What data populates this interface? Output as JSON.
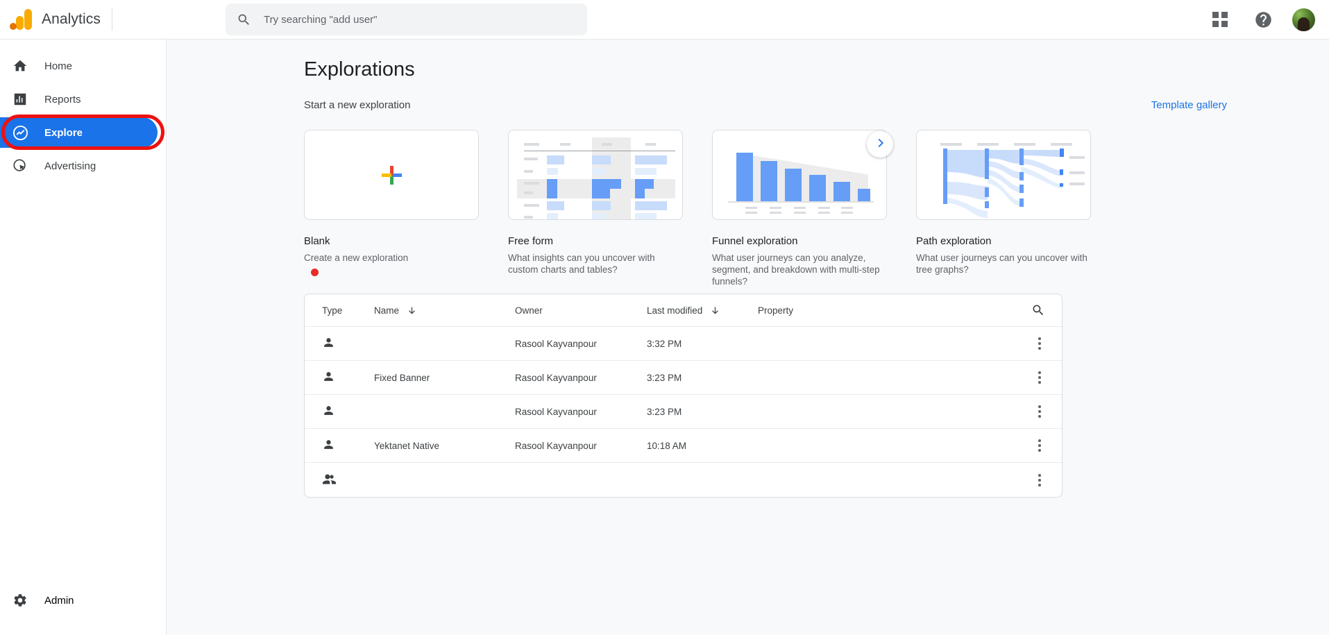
{
  "topbar": {
    "brand": "Analytics",
    "search": {
      "placeholder": "Try searching \"add user\"",
      "value": "",
      "icon": "search-icon"
    },
    "apps_icon": "apps-grid-icon",
    "help_icon": "help-circle-icon",
    "avatar": "user-avatar"
  },
  "sidebar": {
    "items": [
      {
        "label": "Home",
        "icon": "home-icon",
        "active": false
      },
      {
        "label": "Reports",
        "icon": "bar-chart-icon",
        "active": false
      },
      {
        "label": "Explore",
        "icon": "explore-compass-icon",
        "active": true
      },
      {
        "label": "Advertising",
        "icon": "advertising-cursor-icon",
        "active": false
      }
    ],
    "admin": {
      "label": "Admin",
      "icon": "gear-icon"
    }
  },
  "main": {
    "page_title": "Explorations",
    "section_subtitle": "Start a new exploration",
    "template_gallery_link": "Template gallery",
    "next_arrow_icon": "chevron-right-icon",
    "cards": [
      {
        "title": "Blank",
        "desc": "Create a new exploration",
        "thumb": "plus-icon",
        "highlighted": true
      },
      {
        "title": "Free form",
        "desc": "What insights can you uncover with custom charts and tables?",
        "thumb": "free-form-table-thumb",
        "highlighted": false
      },
      {
        "title": "Funnel exploration",
        "desc": "What user journeys can you analyze, segment, and breakdown with multi-step funnels?",
        "thumb": "funnel-bars-thumb",
        "highlighted": false
      },
      {
        "title": "Path exploration",
        "desc": "What user journeys can you uncover with tree graphs?",
        "thumb": "path-sankey-thumb",
        "highlighted": false
      }
    ]
  },
  "table": {
    "columns": [
      {
        "label": "Type",
        "sort": ""
      },
      {
        "label": "Name",
        "sort": "down-arrow-icon"
      },
      {
        "label": "Owner",
        "sort": ""
      },
      {
        "label": "Last modified",
        "sort": "down-arrow-icon"
      },
      {
        "label": "Property",
        "sort": ""
      }
    ],
    "search_icon": "search-icon",
    "rows": [
      {
        "type_icon": "person-icon",
        "name": "",
        "owner": "Rasool Kayvanpour",
        "modified": "3:32 PM",
        "property": "",
        "menu_icon": "more-vert-icon"
      },
      {
        "type_icon": "person-icon",
        "name": "Fixed Banner",
        "owner": "Rasool Kayvanpour",
        "modified": "3:23 PM",
        "property": "",
        "menu_icon": "more-vert-icon"
      },
      {
        "type_icon": "person-icon",
        "name": "",
        "owner": "Rasool Kayvanpour",
        "modified": "3:23 PM",
        "property": "",
        "menu_icon": "more-vert-icon"
      },
      {
        "type_icon": "person-icon",
        "name": "Yektanet Native",
        "owner": "Rasool Kayvanpour",
        "modified": "10:18 AM",
        "property": "",
        "menu_icon": "more-vert-icon"
      },
      {
        "type_icon": "people-group-icon",
        "name": "",
        "owner": "",
        "modified": "",
        "property": "",
        "menu_icon": "more-vert-icon"
      }
    ]
  },
  "colors": {
    "accent_blue": "#1a73e8",
    "annotation_red": "#ee1111",
    "logo_orange": "#f9ab00",
    "surface_gray": "#f8f9fa"
  }
}
